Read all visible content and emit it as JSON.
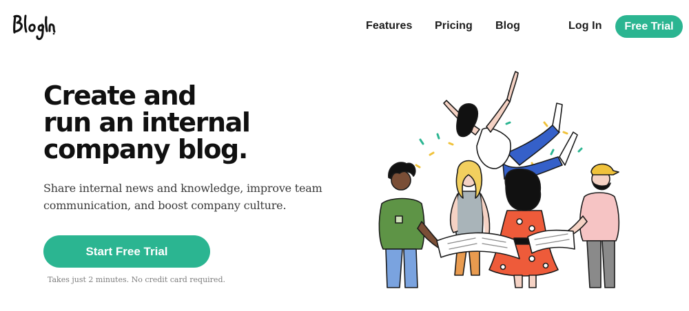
{
  "brand": {
    "logo_text": "BlogIn"
  },
  "nav": {
    "items": [
      {
        "label": "Features"
      },
      {
        "label": "Pricing"
      },
      {
        "label": "Blog"
      }
    ],
    "login_label": "Log In",
    "cta_label": "Free Trial"
  },
  "hero": {
    "title_lines": [
      "Create and",
      "run an internal",
      "company blog."
    ],
    "subtitle_lines": [
      "Share internal news and knowledge, improve team",
      "communication, and boost company culture."
    ],
    "cta_label": "Start Free Trial",
    "note": "Takes just 2 minutes. No credit card required."
  },
  "colors": {
    "accent": "#2bb591",
    "text": "#101010",
    "muted": "#7c7c7c"
  },
  "illustration": {
    "name": "team-celebration-illustration"
  }
}
